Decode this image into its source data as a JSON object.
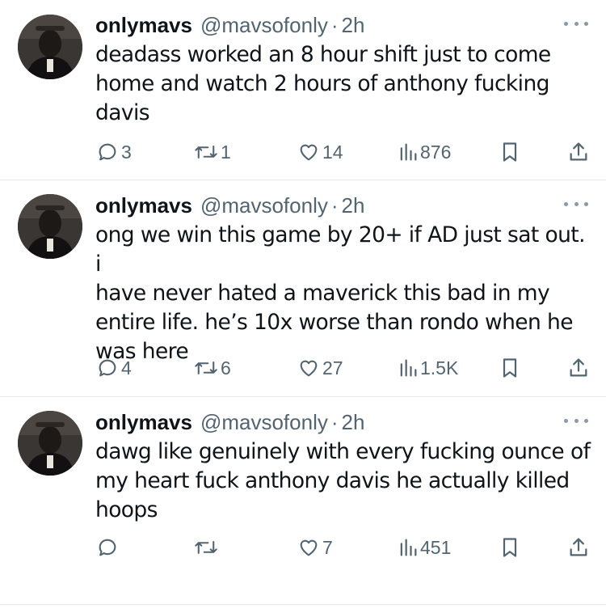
{
  "tweets": [
    {
      "name": "onlymavs",
      "handle": "@mavsofonly",
      "separator": "·",
      "time": "2h",
      "text": "deadass worked an 8 hour shift just to come\nhome and watch 2 hours of anthony fucking\ndavis",
      "replies": "3",
      "retweets": "1",
      "likes": "14",
      "views": "876"
    },
    {
      "name": "onlymavs",
      "handle": "@mavsofonly",
      "separator": "·",
      "time": "2h",
      "text": "ong we win this game by 20+ if AD just sat out. i\nhave never hated a maverick this bad in my\nentire life. he’s 10x worse than rondo when he\nwas here",
      "replies": "4",
      "retweets": "6",
      "likes": "27",
      "views": "1.5K"
    },
    {
      "name": "onlymavs",
      "handle": "@mavsofonly",
      "separator": "·",
      "time": "2h",
      "text": "dawg like genuinely with every fucking ounce of\nmy heart fuck anthony davis he actually killed\nhoops",
      "replies": "",
      "retweets": "",
      "likes": "7",
      "views": "451"
    }
  ],
  "icons": {
    "reply": "reply-icon",
    "retweet": "retweet-icon",
    "like": "heart-icon",
    "views": "views-icon",
    "bookmark": "bookmark-icon",
    "share": "share-icon",
    "more": "more-icon"
  },
  "colors": {
    "text": "#0f1419",
    "secondary": "#536471",
    "divider": "#e6e9ec"
  }
}
